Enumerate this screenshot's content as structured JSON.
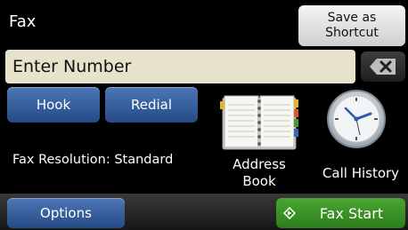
{
  "header": {
    "title": "Fax",
    "shortcut": {
      "line1": "Save as",
      "line2": "Shortcut"
    }
  },
  "number_input": {
    "value": "Enter Number"
  },
  "buttons": {
    "hook": "Hook",
    "redial": "Redial",
    "options": "Options",
    "fax_start": "Fax Start"
  },
  "status": {
    "fax_resolution": "Fax Resolution: Standard"
  },
  "address_book": {
    "line1": "Address",
    "line2": "Book"
  },
  "call_history": {
    "label": "Call History"
  },
  "icons": {
    "backspace": "backspace-icon",
    "address_book": "address-book-icon",
    "call_history": "clock-icon",
    "start": "start-icon"
  },
  "colors": {
    "blue_button": "#3a62a0",
    "green_button": "#3c952a",
    "number_field": "#e6e2cb"
  }
}
